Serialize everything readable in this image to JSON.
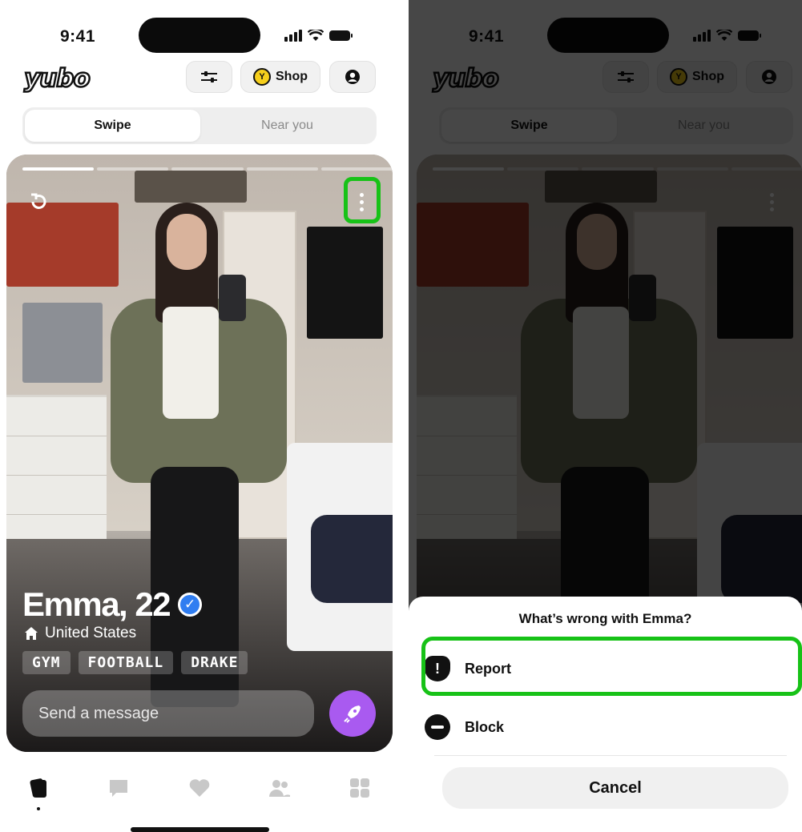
{
  "status": {
    "time": "9:41"
  },
  "header": {
    "logo": "yubo",
    "shop_label": "Shop",
    "coin_glyph": "Y"
  },
  "segmented": {
    "active": "Swipe",
    "inactive": "Near you"
  },
  "profile": {
    "name": "Emma, 22",
    "location": "United States",
    "tags": [
      "GYM",
      "FOOTBALL",
      "DRAKE"
    ],
    "message_placeholder": "Send a message"
  },
  "tabbar": {
    "items": [
      "cards-icon",
      "chat-icon",
      "heart-icon",
      "friends-icon",
      "grid-icon"
    ]
  },
  "sheet": {
    "title": "What’s wrong with Emma?",
    "report_label": "Report",
    "block_label": "Block",
    "cancel_label": "Cancel"
  },
  "colors": {
    "highlight": "#17c217",
    "boost": "#a95af0",
    "verified": "#2f7df1"
  }
}
